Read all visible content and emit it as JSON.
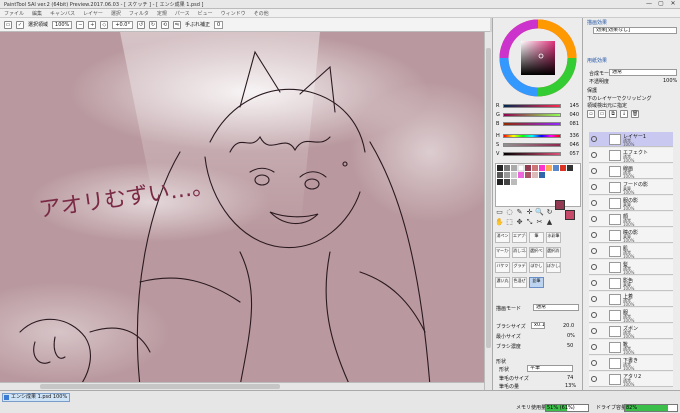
{
  "window": {
    "title": "PaintTool SAI ver.2 (64bit) Preview.2017.06.03 - [ スケッチ ] - [ エンシ成果 1.psd ]",
    "controls": [
      "—",
      "▢",
      "✕"
    ]
  },
  "menu": [
    "ファイル",
    "編集",
    "キャンバス",
    "レイヤー",
    "選択",
    "フィルタ",
    "定規",
    "パース",
    "ビュー",
    "ウィンドウ",
    "その他"
  ],
  "toolbar": {
    "selection_label": "選択領域",
    "zoom": "100%",
    "rotation": "+0.0°",
    "stabilizer_label": "手ぶれ補正",
    "stabilizer_value": "0"
  },
  "canvas": {
    "handwriting": "アオリむずい…。"
  },
  "color_panel": {
    "rgb": [
      {
        "label": "R",
        "value": "145"
      },
      {
        "label": "G",
        "value": "040"
      },
      {
        "label": "B",
        "value": "081"
      }
    ],
    "hsv": [
      {
        "label": "H",
        "value": "336"
      },
      {
        "label": "S",
        "value": "046"
      },
      {
        "label": "V",
        "value": "057"
      }
    ],
    "accent_color": "#913a52"
  },
  "tools": [
    [
      "消ペン",
      "エアブラシ",
      "筆",
      "水彩筆"
    ],
    [
      "マーカー",
      "消しゴム",
      "選択ペン",
      "選択消し"
    ],
    [
      "バケツ",
      "グラデ",
      "ぼかし",
      "ぼかし消し"
    ],
    [
      "濃い丸",
      "色混ぜ",
      "鉛筆",
      ""
    ]
  ],
  "brush": {
    "mode_label": "描画モード",
    "mode_value": "通常",
    "size_label": "ブラシサイズ",
    "size_mult": "x0.1",
    "size_value": "20.0",
    "min_size_label": "最小サイズ",
    "min_size_value": "0%",
    "density_label": "ブラシ濃度",
    "density_value": "50",
    "shape_section": "形状",
    "shape_label": "形状",
    "shape_value": "平筆",
    "shape_size_label": "筆毛のサイズ",
    "shape_size_value": "74",
    "shape_density_label": "筆毛の量",
    "shape_density_value": "13%"
  },
  "right_panel": {
    "effects_title": "描画効果",
    "effects_value": "効果[効果なし]",
    "layer_props_title": "用紙効果",
    "blend_label": "合成モード",
    "blend_value": "通常",
    "opacity_label": "不透明度",
    "opacity_value": "100%",
    "protect_label": "保護",
    "clip_label": "下のレイヤーでクリッピング",
    "ref_label": "領域検出元に指定"
  },
  "layers": [
    {
      "name": "レイヤー1",
      "mode": "通常",
      "opacity": "100%",
      "selected": true
    },
    {
      "name": "エフェクト",
      "mode": "通常",
      "opacity": "100%",
      "selected": false
    },
    {
      "name": "線画",
      "mode": "通常",
      "opacity": "100%",
      "selected": false
    },
    {
      "name": "フードの影",
      "mode": "乗算",
      "opacity": "100%",
      "selected": false
    },
    {
      "name": "服の影",
      "mode": "乗算",
      "opacity": "100%",
      "selected": false
    },
    {
      "name": "顔",
      "mode": "通常",
      "opacity": "100%",
      "selected": false
    },
    {
      "name": "瞳の影",
      "mode": "乗算",
      "opacity": "100%",
      "selected": false
    },
    {
      "name": "肌",
      "mode": "通常",
      "opacity": "100%",
      "selected": false
    },
    {
      "name": "髪",
      "mode": "通常",
      "opacity": "100%",
      "selected": false
    },
    {
      "name": "影色",
      "mode": "乗算",
      "opacity": "100%",
      "selected": false
    },
    {
      "name": "上着",
      "mode": "通常",
      "opacity": "100%",
      "selected": false
    },
    {
      "name": "服",
      "mode": "通常",
      "opacity": "100%",
      "selected": false
    },
    {
      "name": "ズボン",
      "mode": "通常",
      "opacity": "100%",
      "selected": false
    },
    {
      "name": "靴",
      "mode": "通常",
      "opacity": "100%",
      "selected": false
    },
    {
      "name": "下書き",
      "mode": "通常",
      "opacity": "100%",
      "selected": false
    },
    {
      "name": "アタリ2",
      "mode": "通常",
      "opacity": "100%",
      "selected": false
    }
  ],
  "status": {
    "file_tab": "エンシ成果 1.psd",
    "file_zoom": "100%",
    "memory_label": "メモリ使用量",
    "memory_value": "51% (61%)",
    "memory_percent": 51,
    "drive_label": "ドライブ容量",
    "drive_value": "82%",
    "drive_percent": 82
  }
}
